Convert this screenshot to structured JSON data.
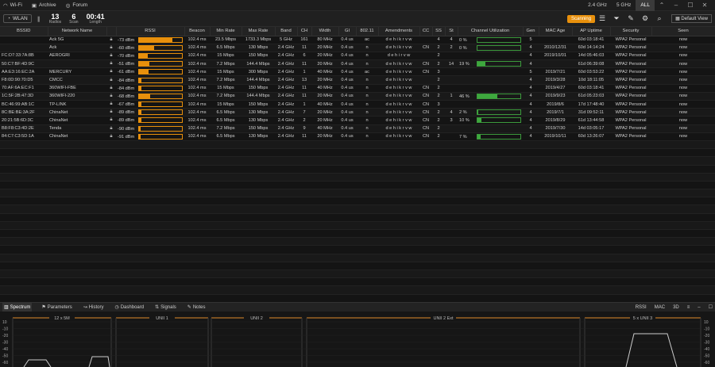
{
  "topbar": {
    "menu": [
      {
        "icon": "wifi-icon",
        "label": "Wi-Fi"
      },
      {
        "icon": "archive-icon",
        "label": "Archive"
      },
      {
        "icon": "forum-icon",
        "label": "Forum"
      }
    ],
    "bands": [
      "2.4 GHz",
      "5 GHz",
      "ALL"
    ],
    "active_band": "ALL"
  },
  "toolbar": {
    "interface": "WLAN",
    "radios": {
      "value": "13",
      "label": "Radios"
    },
    "scan": {
      "value": "6",
      "label": "Scan"
    },
    "length": {
      "value": "00:41",
      "label": "Length"
    },
    "scan_button": "Scanning",
    "view": "Default View"
  },
  "table": {
    "columns": [
      "BSSID",
      "Network Name",
      "",
      "RSSI",
      "Beacon",
      "Min Rate",
      "Max Rate",
      "Band",
      "CH",
      "Width",
      "GI",
      "802.11",
      "Amendments",
      "CC",
      "SS",
      "St",
      "Channel Utilization",
      "Gen",
      "MAC Age",
      "AP Uptime",
      "Security",
      "Seen"
    ],
    "rows": [
      {
        "bssid": "",
        "name": "Ack 5G",
        "rssi": "-73 dBm",
        "rssi_level": 0.78,
        "beacon": "102.4 ms",
        "min": "23.5 Mbps",
        "max": "1733.3 Mbps",
        "band": "5 GHz",
        "ch": "161",
        "width": "80 MHz",
        "gi": "0.4 us",
        "std": "ac",
        "amend": "d e h i k r v w",
        "cc": "",
        "ss": "4",
        "st": "4",
        "cu": "0 %",
        "cu_level": 0.0,
        "gen": "5",
        "macage": "",
        "uptime": "60d 03:18:41",
        "sec": "WPA2 Personal",
        "seen": "now"
      },
      {
        "bssid": "",
        "name": "Ack",
        "rssi": "-60 dBm",
        "rssi_level": 0.36,
        "beacon": "102.4 ms",
        "min": "6.5 Mbps",
        "max": "130 Mbps",
        "band": "2.4 GHz",
        "ch": "11",
        "width": "20 MHz",
        "gi": "0.4 us",
        "std": "n",
        "amend": "d e h i k r v w",
        "cc": "CN",
        "ss": "2",
        "st": "2",
        "cu": "0 %",
        "cu_level": 0.0,
        "gen": "4",
        "macage": "2010/12/31",
        "uptime": "60d 14:14:24",
        "sec": "WPA2 Personal",
        "seen": "now"
      },
      {
        "bssid": "FC:D7:33:7A:8B",
        "name": "AEROGRI",
        "rssi": "-70 dBm",
        "rssi_level": 0.2,
        "beacon": "102.4 ms",
        "min": "15 Mbps",
        "max": "150 Mbps",
        "band": "2.4 GHz",
        "ch": "6",
        "width": "20 MHz",
        "gi": "0.4 us",
        "std": "n",
        "amend": "d e h i r v w",
        "cc": "",
        "ss": "2",
        "st": "",
        "cu": "",
        "cu_level": null,
        "gen": "4",
        "macage": "2019/10/01",
        "uptime": "14d 05:46:03",
        "sec": "WPA2 Personal",
        "seen": "now"
      },
      {
        "bssid": "50:C7:BF:4D:9C",
        "name": "",
        "rssi": "-51 dBm",
        "rssi_level": 0.24,
        "beacon": "102.4 ms",
        "min": "7.2 Mbps",
        "max": "144.4 Mbps",
        "band": "2.4 GHz",
        "ch": "11",
        "width": "20 MHz",
        "gi": "0.4 us",
        "std": "n",
        "amend": "d e h i k r v w",
        "cc": "CN",
        "ss": "2",
        "st": "14",
        "cu": "19 %",
        "cu_level": 0.19,
        "gen": "4",
        "macage": "",
        "uptime": "61d 06:39:08",
        "sec": "WPA2 Personal",
        "seen": "now"
      },
      {
        "bssid": "AA:E3:16:EC:2A",
        "name": "MERCURY",
        "rssi": "-61 dBm",
        "rssi_level": 0.22,
        "beacon": "102.4 ms",
        "min": "15 Mbps",
        "max": "300 Mbps",
        "band": "2.4 GHz",
        "ch": "1",
        "width": "40 MHz",
        "gi": "0.4 us",
        "std": "ac",
        "amend": "d e h i k r v w",
        "cc": "CN",
        "ss": "3",
        "st": "",
        "cu": "",
        "cu_level": null,
        "gen": "5",
        "macage": "2019/7/21",
        "uptime": "60d 03:53:22",
        "sec": "WPA2 Personal",
        "seen": "now"
      },
      {
        "bssid": "F8:0D:90:70:D5",
        "name": "CMCC",
        "rssi": "-84 dBm",
        "rssi_level": 0.05,
        "beacon": "102.4 ms",
        "min": "7.2 Mbps",
        "max": "144.4 Mbps",
        "band": "2.4 GHz",
        "ch": "13",
        "width": "20 MHz",
        "gi": "0.4 us",
        "std": "n",
        "amend": "d e h i k r v w",
        "cc": "",
        "ss": "2",
        "st": "",
        "cu": "",
        "cu_level": null,
        "gen": "4",
        "macage": "2019/3/28",
        "uptime": "10d 18:11:05",
        "sec": "WPA2 Personal",
        "seen": "now"
      },
      {
        "bssid": "70:AF:6A:EC:F1",
        "name": "360WIFI-FBE",
        "rssi": "-84 dBm",
        "rssi_level": 0.05,
        "beacon": "102.4 ms",
        "min": "15 Mbps",
        "max": "150 Mbps",
        "band": "2.4 GHz",
        "ch": "11",
        "width": "40 MHz",
        "gi": "0.4 us",
        "std": "n",
        "amend": "d e h i k r v w",
        "cc": "CN",
        "ss": "2",
        "st": "",
        "cu": "",
        "cu_level": null,
        "gen": "4",
        "macage": "2019/4/27",
        "uptime": "60d 03:18:41",
        "sec": "WPA2 Personal",
        "seen": "now"
      },
      {
        "bssid": "1C:5F:2B:47:3D",
        "name": "360WIFI-220",
        "rssi": "-68 dBm",
        "rssi_level": 0.26,
        "beacon": "102.4 ms",
        "min": "7.2 Mbps",
        "max": "144.4 Mbps",
        "band": "2.4 GHz",
        "ch": "11",
        "width": "20 MHz",
        "gi": "0.4 us",
        "std": "n",
        "amend": "d e h i k r v w",
        "cc": "CN",
        "ss": "2",
        "st": "1",
        "cu": "46 %",
        "cu_level": 0.46,
        "gen": "4",
        "macage": "2019/9/23",
        "uptime": "61d 05:23:03",
        "sec": "WPA2 Personal",
        "seen": "now"
      },
      {
        "bssid": "BC:46:99:AB:1C",
        "name": "TP-LINK",
        "rssi": "-67 dBm",
        "rssi_level": 0.06,
        "beacon": "102.4 ms",
        "min": "15 Mbps",
        "max": "150 Mbps",
        "band": "2.4 GHz",
        "ch": "1",
        "width": "40 MHz",
        "gi": "0.4 us",
        "std": "n",
        "amend": "d e h i k r v w",
        "cc": "CN",
        "ss": "3",
        "st": "",
        "cu": "",
        "cu_level": null,
        "gen": "4",
        "macage": "2019/8/6",
        "uptime": "17d 17:48:40",
        "sec": "WPA2 Personal",
        "seen": "now"
      },
      {
        "bssid": "8C:BE:BE:3A:2F",
        "name": "ChinaNet",
        "rssi": "-89 dBm",
        "rssi_level": 0.05,
        "beacon": "102.4 ms",
        "min": "6.5 Mbps",
        "max": "130 Mbps",
        "band": "2.4 GHz",
        "ch": "7",
        "width": "20 MHz",
        "gi": "0.4 us",
        "std": "n",
        "amend": "d e h i k r v w",
        "cc": "CN",
        "ss": "2",
        "st": "4",
        "cu": "2 %",
        "cu_level": 0.02,
        "gen": "4",
        "macage": "2019/7/1",
        "uptime": "31d 09:52:11",
        "sec": "WPA2 Personal",
        "seen": "now"
      },
      {
        "bssid": "20:21:5B:6D:3C",
        "name": "ChinaNet",
        "rssi": "-89 dBm",
        "rssi_level": 0.05,
        "beacon": "102.4 ms",
        "min": "6.5 Mbps",
        "max": "130 Mbps",
        "band": "2.4 GHz",
        "ch": "2",
        "width": "20 MHz",
        "gi": "0.4 us",
        "std": "n",
        "amend": "d e h i k r v w",
        "cc": "CN",
        "ss": "2",
        "st": "3",
        "cu": "10 %",
        "cu_level": 0.1,
        "gen": "4",
        "macage": "2019/8/29",
        "uptime": "61d 13:44:58",
        "sec": "WPA2 Personal",
        "seen": "now"
      },
      {
        "bssid": "B8:F8:C3:4D:2E",
        "name": "Tenda",
        "rssi": "-90 dBm",
        "rssi_level": 0.04,
        "beacon": "102.4 ms",
        "min": "7.2 Mbps",
        "max": "150 Mbps",
        "band": "2.4 GHz",
        "ch": "9",
        "width": "40 MHz",
        "gi": "0.4 us",
        "std": "n",
        "amend": "d e h i k r v w",
        "cc": "CN",
        "ss": "2",
        "st": "",
        "cu": "",
        "cu_level": null,
        "gen": "4",
        "macage": "2019/7/30",
        "uptime": "14d 03:05:17",
        "sec": "WPA2 Personal",
        "seen": "now"
      },
      {
        "bssid": "84:C7:C3:5D:1A",
        "name": "ChinaNet",
        "rssi": "-91 dBm",
        "rssi_level": 0.04,
        "beacon": "102.4 ms",
        "min": "6.5 Mbps",
        "max": "130 Mbps",
        "band": "2.4 GHz",
        "ch": "11",
        "width": "20 MHz",
        "gi": "0.4 us",
        "std": "n",
        "amend": "d e h i k r v w",
        "cc": "CN",
        "ss": "2",
        "st": "",
        "cu": "7 %",
        "cu_level": 0.07,
        "gen": "4",
        "macage": "2019/10/11",
        "uptime": "60d 13:26:07",
        "sec": "WPA2 Personal",
        "seen": "now"
      }
    ]
  },
  "bottom": {
    "tabs": [
      {
        "icon": "spectrum-icon",
        "label": "Spectrum"
      },
      {
        "icon": "flag-icon",
        "label": "Parameters"
      },
      {
        "icon": "history-icon",
        "label": "History"
      },
      {
        "icon": "dashboard-icon",
        "label": "Dashboard"
      },
      {
        "icon": "signals-icon",
        "label": "Signals"
      },
      {
        "icon": "notes-icon",
        "label": "Notes"
      }
    ],
    "active_tab": "Spectrum",
    "right_tools": [
      "RSSI",
      "MAC",
      "3D"
    ],
    "y_ticks": [
      "10",
      "-10",
      "-20",
      "-30",
      "-40",
      "-50",
      "-60"
    ],
    "segments": [
      "12 x 5M",
      "UNII 1",
      "UNII 2",
      "UNII 2 Ext",
      "5 x UNII 3"
    ]
  }
}
